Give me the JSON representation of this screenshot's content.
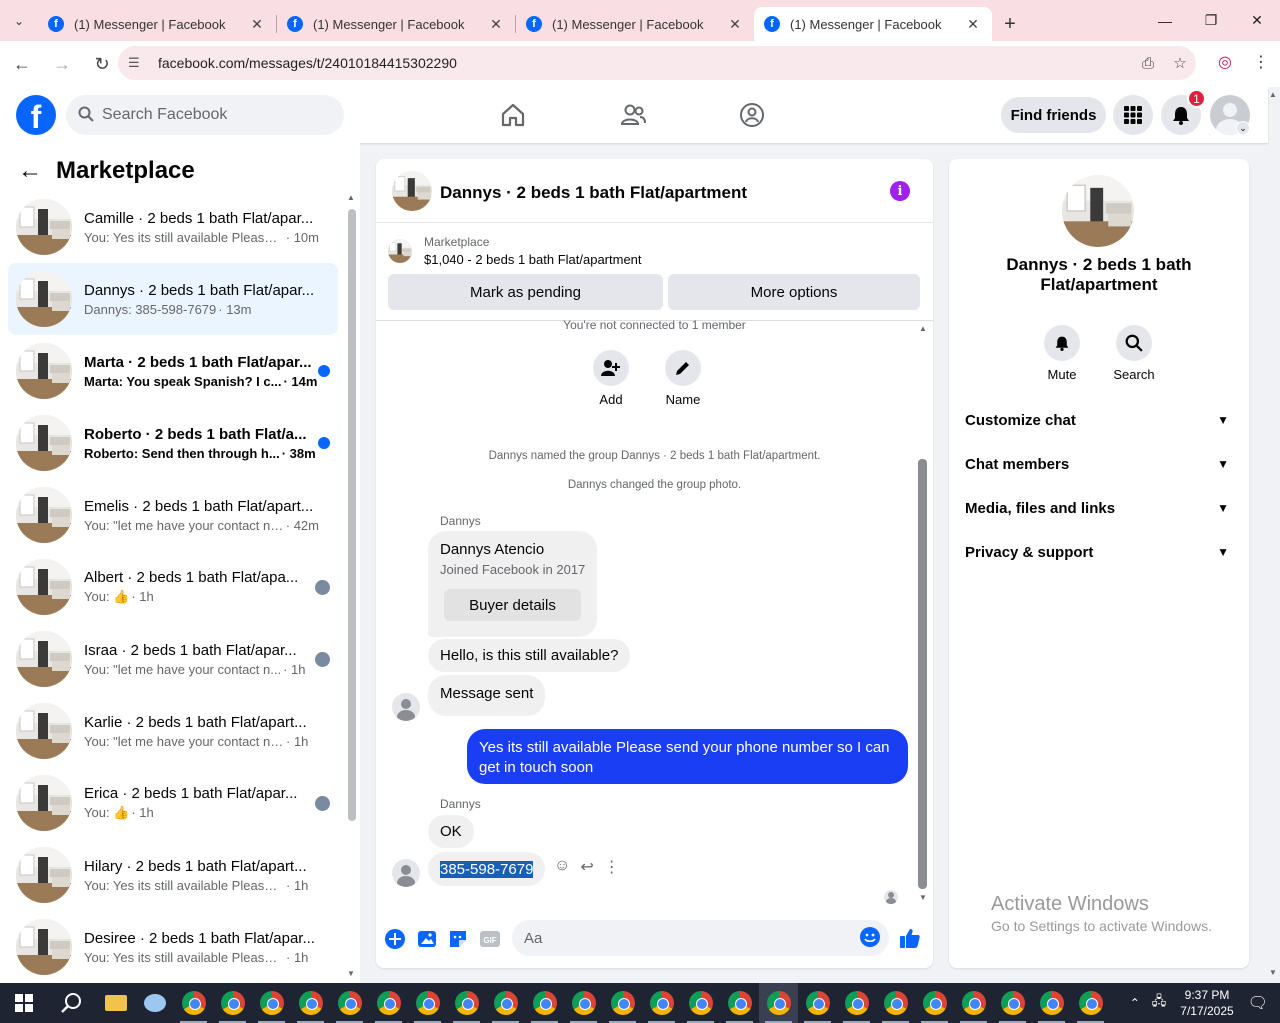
{
  "browser": {
    "tabs": [
      {
        "title": "(1) Messenger | Facebook",
        "active": false
      },
      {
        "title": "(1) Messenger | Facebook",
        "active": false
      },
      {
        "title": "(1) Messenger | Facebook",
        "active": false
      },
      {
        "title": "(1) Messenger | Facebook",
        "active": true
      }
    ],
    "url": "facebook.com/messages/t/24010184415302290"
  },
  "fb": {
    "search_placeholder": "Search Facebook",
    "find_friends": "Find friends",
    "notif_count": "1"
  },
  "sidebar": {
    "title": "Marketplace",
    "conversations": [
      {
        "name": "Camille · 2 beds 1 bath Flat/apar...",
        "preview": "You: Yes its still available Please s...",
        "time": "· 10m",
        "state": "read"
      },
      {
        "name": "Dannys · 2 beds 1 bath Flat/apar...",
        "preview": "Dannys: 385-598-7679",
        "time": "· 13m",
        "state": "active"
      },
      {
        "name": "Marta · 2 beds 1 bath Flat/apar...",
        "preview": "Marta: You speak Spanish? I c...",
        "time": "· 14m",
        "state": "unread"
      },
      {
        "name": "Roberto · 2 beds 1 bath Flat/a...",
        "preview": "Roberto: Send then through h...",
        "time": "· 38m",
        "state": "unread"
      },
      {
        "name": "Emelis · 2 beds 1 bath Flat/apart...",
        "preview": "You: \"let me have your contact nu...",
        "time": "· 42m",
        "state": "read"
      },
      {
        "name": "Albert · 2 beds 1 bath Flat/apa...",
        "preview": "You: 👍",
        "time": "· 1h",
        "state": "seen"
      },
      {
        "name": "Israa · 2 beds 1 bath Flat/apar...",
        "preview": "You: \"let me have your contact n...",
        "time": "· 1h",
        "state": "seen"
      },
      {
        "name": "Karlie · 2 beds 1 bath Flat/apart...",
        "preview": "You: \"let me have your contact num...",
        "time": "· 1h",
        "state": "read"
      },
      {
        "name": "Erica · 2 beds 1 bath Flat/apar...",
        "preview": "You: 👍",
        "time": "· 1h",
        "state": "seen"
      },
      {
        "name": "Hilary · 2 beds 1 bath Flat/apart...",
        "preview": "You: Yes its still available Please sen...",
        "time": "· 1h",
        "state": "read"
      },
      {
        "name": "Desiree · 2 beds 1 bath Flat/apar...",
        "preview": "You: Yes its still available Please sen...",
        "time": "· 1h",
        "state": "read"
      }
    ]
  },
  "chat": {
    "title": "Dannys · 2 beds 1 bath Flat/apartment",
    "marketplace_label": "Marketplace",
    "listing": "$1,040 - 2 beds 1 bath Flat/apartment",
    "mark_pending": "Mark as pending",
    "more_options": "More options",
    "not_connected": "You're not connected to 1 member",
    "add_label": "Add",
    "name_label": "Name",
    "sys1": "Dannys named the group Dannys · 2 beds 1 bath Flat/apartment.",
    "sys2": "Dannys changed the group photo.",
    "sender": "Dannys",
    "card_name": "Dannys Atencio",
    "card_joined": "Joined Facebook in 2017",
    "buyer_details": "Buyer details",
    "msg_available": "Hello, is this still available?",
    "msg_sent": "Message sent",
    "msg_outgoing": "Yes its still available Please send your phone number so I can get in touch soon",
    "msg_ok": "OK",
    "msg_phone": "385-598-7679",
    "composer_placeholder": "Aa"
  },
  "details": {
    "title": "Dannys · 2 beds 1 bath Flat/apartment",
    "mute": "Mute",
    "search": "Search",
    "sections": [
      "Customize chat",
      "Chat members",
      "Media, files and links",
      "Privacy & support"
    ]
  },
  "watermark": {
    "line1": "Activate Windows",
    "line2": "Go to Settings to activate Windows."
  },
  "taskbar": {
    "time": "9:37 PM",
    "date": "7/17/2025"
  }
}
